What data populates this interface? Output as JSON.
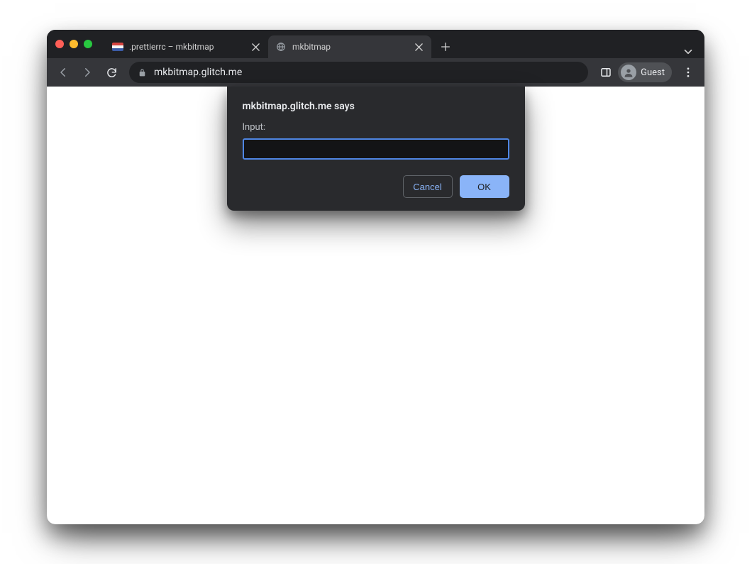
{
  "tabs": [
    {
      "title": ".prettierrc – mkbitmap"
    },
    {
      "title": "mkbitmap"
    }
  ],
  "address_bar": {
    "url": "mkbitmap.glitch.me"
  },
  "profile": {
    "label": "Guest"
  },
  "dialog": {
    "title": "mkbitmap.glitch.me says",
    "prompt_label": "Input:",
    "input_value": "",
    "cancel_label": "Cancel",
    "ok_label": "OK"
  }
}
